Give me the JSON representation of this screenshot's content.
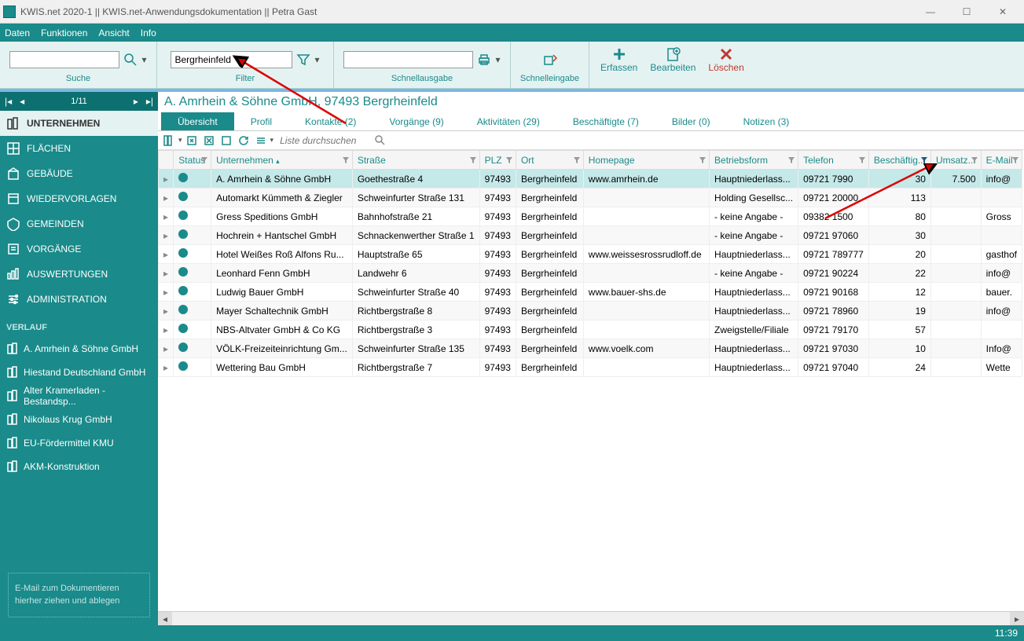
{
  "window": {
    "title": "KWIS.net 2020-1 || KWIS.net-Anwendungsdokumentation || Petra Gast"
  },
  "menu": [
    "Daten",
    "Funktionen",
    "Ansicht",
    "Info"
  ],
  "ribbon": {
    "search_label": "Suche",
    "filter_label": "Filter",
    "filter_value": "Bergrheinfeld",
    "quick_out_label": "Schnellausgabe",
    "quick_in_label": "Schnelleingabe",
    "create_label": "Erfassen",
    "edit_label": "Bearbeiten",
    "delete_label": "Löschen"
  },
  "pager": {
    "text": "1/11"
  },
  "sidebar": {
    "items": [
      {
        "label": "UNTERNEHMEN",
        "active": true
      },
      {
        "label": "FLÄCHEN"
      },
      {
        "label": "GEBÄUDE"
      },
      {
        "label": "WIEDERVORLAGEN"
      },
      {
        "label": "GEMEINDEN"
      },
      {
        "label": "VORGÄNGE"
      },
      {
        "label": "AUSWERTUNGEN"
      },
      {
        "label": "ADMINISTRATION"
      }
    ],
    "history_label": "VERLAUF",
    "history": [
      "A. Amrhein & Söhne GmbH",
      "Hiestand Deutschland GmbH",
      "Alter Kramerladen - Bestandsp...",
      "Nikolaus Krug GmbH",
      "EU-Fördermittel KMU",
      "AKM-Konstruktion"
    ],
    "dropzone": "E-Mail  zum Dokumentieren hierher ziehen und ablegen"
  },
  "record_title": "A. Amrhein & Söhne GmbH, 97493 Bergrheinfeld",
  "tabs": [
    {
      "label": "Übersicht",
      "active": true
    },
    {
      "label": "Profil"
    },
    {
      "label": "Kontakte (2)"
    },
    {
      "label": "Vorgänge (9)"
    },
    {
      "label": "Aktivitäten (29)"
    },
    {
      "label": "Beschäftigte (7)"
    },
    {
      "label": "Bilder (0)"
    },
    {
      "label": "Notizen (3)"
    }
  ],
  "list_search_placeholder": "Liste durchsuchen",
  "columns": [
    "Status",
    "Unternehmen",
    "Straße",
    "PLZ",
    "Ort",
    "Homepage",
    "Betriebsform",
    "Telefon",
    "Beschäftig...",
    "Umsatz...",
    "E-Mail"
  ],
  "rows": [
    {
      "sel": true,
      "u": "A. Amrhein & Söhne GmbH",
      "s": "Goethestraße 4",
      "p": "97493",
      "o": "Bergrheinfeld",
      "h": "www.amrhein.de",
      "b": "Hauptniederlass...",
      "t": "09721 7990",
      "be": "30",
      "um": "7.500",
      "e": "info@"
    },
    {
      "u": "Automarkt Kümmeth & Ziegler",
      "s": "Schweinfurter Straße 131",
      "p": "97493",
      "o": "Bergrheinfeld",
      "h": "",
      "b": "Holding Gesellsc...",
      "t": "09721 20000",
      "be": "113",
      "um": "",
      "e": ""
    },
    {
      "u": "Gress Speditions GmbH",
      "s": "Bahnhofstraße 21",
      "p": "97493",
      "o": "Bergrheinfeld",
      "h": "",
      "b": "- keine Angabe -",
      "t": "09382 1500",
      "be": "80",
      "um": "",
      "e": "Gross"
    },
    {
      "u": "Hochrein + Hantschel GmbH",
      "s": "Schnackenwerther Straße 1",
      "p": "97493",
      "o": "Bergrheinfeld",
      "h": "",
      "b": "- keine Angabe -",
      "t": "09721 97060",
      "be": "30",
      "um": "",
      "e": ""
    },
    {
      "u": "Hotel Weißes Roß Alfons Ru...",
      "s": "Hauptstraße 65",
      "p": "97493",
      "o": "Bergrheinfeld",
      "h": "www.weissesrossrudloff.de",
      "b": "Hauptniederlass...",
      "t": "09721 789777",
      "be": "20",
      "um": "",
      "e": "gasthof"
    },
    {
      "u": "Leonhard Fenn GmbH",
      "s": "Landwehr 6",
      "p": "97493",
      "o": "Bergrheinfeld",
      "h": "",
      "b": "- keine Angabe -",
      "t": "09721 90224",
      "be": "22",
      "um": "",
      "e": "info@"
    },
    {
      "u": "Ludwig Bauer GmbH",
      "s": "Schweinfurter Straße 40",
      "p": "97493",
      "o": "Bergrheinfeld",
      "h": "www.bauer-shs.de",
      "b": "Hauptniederlass...",
      "t": "09721 90168",
      "be": "12",
      "um": "",
      "e": "bauer."
    },
    {
      "u": "Mayer Schaltechnik GmbH",
      "s": "Richtbergstraße 8",
      "p": "97493",
      "o": "Bergrheinfeld",
      "h": "",
      "b": "Hauptniederlass...",
      "t": "09721 78960",
      "be": "19",
      "um": "",
      "e": "info@"
    },
    {
      "u": "NBS-Altvater GmbH & Co KG",
      "s": "Richtbergstraße 3",
      "p": "97493",
      "o": "Bergrheinfeld",
      "h": "",
      "b": "Zweigstelle/Filiale",
      "t": "09721 79170",
      "be": "57",
      "um": "",
      "e": ""
    },
    {
      "u": "VÖLK-Freizeiteinrichtung Gm...",
      "s": "Schweinfurter Straße 135",
      "p": "97493",
      "o": "Bergrheinfeld",
      "h": "www.voelk.com",
      "b": "Hauptniederlass...",
      "t": "09721 97030",
      "be": "10",
      "um": "",
      "e": "Info@"
    },
    {
      "u": "Wettering Bau GmbH",
      "s": "Richtbergstraße 7",
      "p": "97493",
      "o": "Bergrheinfeld",
      "h": "",
      "b": "Hauptniederlass...",
      "t": "09721 97040",
      "be": "24",
      "um": "",
      "e": "Wette"
    }
  ],
  "status_time": "11:39"
}
